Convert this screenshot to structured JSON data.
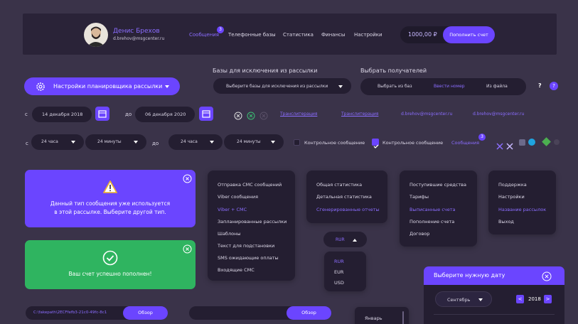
{
  "header": {
    "user_name": "Денис Брехов",
    "user_email": "d.brehov@msgcenter.ru",
    "nav": [
      "Сообщения",
      "Телефонные базы",
      "Статистика",
      "Финансы",
      "Настройки"
    ],
    "messages_badge": "3",
    "balance": "1000,00 ₽",
    "topup_label": "Пополнить счет"
  },
  "scheduler_label": "Настройки планировщика рассылки",
  "exclude": {
    "title": "Базы для исключения из рассылки",
    "placeholder": "Выберите базы для исключения из рассылки"
  },
  "recipients": {
    "title": "Выбрать получателей",
    "options": [
      "Выбрать из баз",
      "Ввести номер",
      "Из файла"
    ]
  },
  "help_labels": [
    "?",
    "?"
  ],
  "dates": {
    "from_label": "с",
    "from": "14 декабря 2018",
    "to_label": "до",
    "to": "06 декабря 2020"
  },
  "links": [
    "Транслитерация",
    "Транслитерация",
    "d.brehov@msgcenter.ru",
    "d.brehov@msgcenter.ru"
  ],
  "time": {
    "from_label": "с",
    "to_label": "до",
    "hours1": "24 часа",
    "minutes1": "24 минуты",
    "hours2": "24 часа",
    "minutes2": "24 минуты"
  },
  "control_msg": [
    "Контрольное сообщение",
    "Контрольное сообщение"
  ],
  "messages_link": "Сообщения",
  "messages_badge2": "3",
  "alert_warning": {
    "line1": "Данный тип сообщения уже используется",
    "line2": "в этой рассылке. Выберите другой тип."
  },
  "alert_success": "Ваш счет успешно пополнен!",
  "menu1": [
    "Отправка СМС сообщений",
    "Viber сообщения",
    "Viber + СМС",
    "Запланированные рассылки",
    "Шаблоны",
    "Текст для подстановки",
    "SMS ожидающие оплаты",
    "Входящие СМС"
  ],
  "menu2": [
    "Общая статистика",
    "Детальная статистика",
    "Сгенерированные отчеты"
  ],
  "menu3": [
    "Поступившие средства",
    "Тарифы",
    "Выписанные счета",
    "Пополнение счета",
    "Договор"
  ],
  "menu4": [
    "Поддержка",
    "Настройки",
    "Название рассылок",
    "Выход"
  ],
  "currency": {
    "selected": "RUR",
    "options": [
      "RUR",
      "EUR",
      "USD"
    ]
  },
  "file1": {
    "path": "C:\\fakepath\\2ECFfefb3-21c0-49fc-8c1",
    "button": "Обзор"
  },
  "file2": {
    "button": "Обзор"
  },
  "month_list": [
    "Январь"
  ],
  "datepicker": {
    "title": "Выберите нужную дату",
    "month": "Сентябрь",
    "year": "2018",
    "prev": "<",
    "next": ">"
  }
}
